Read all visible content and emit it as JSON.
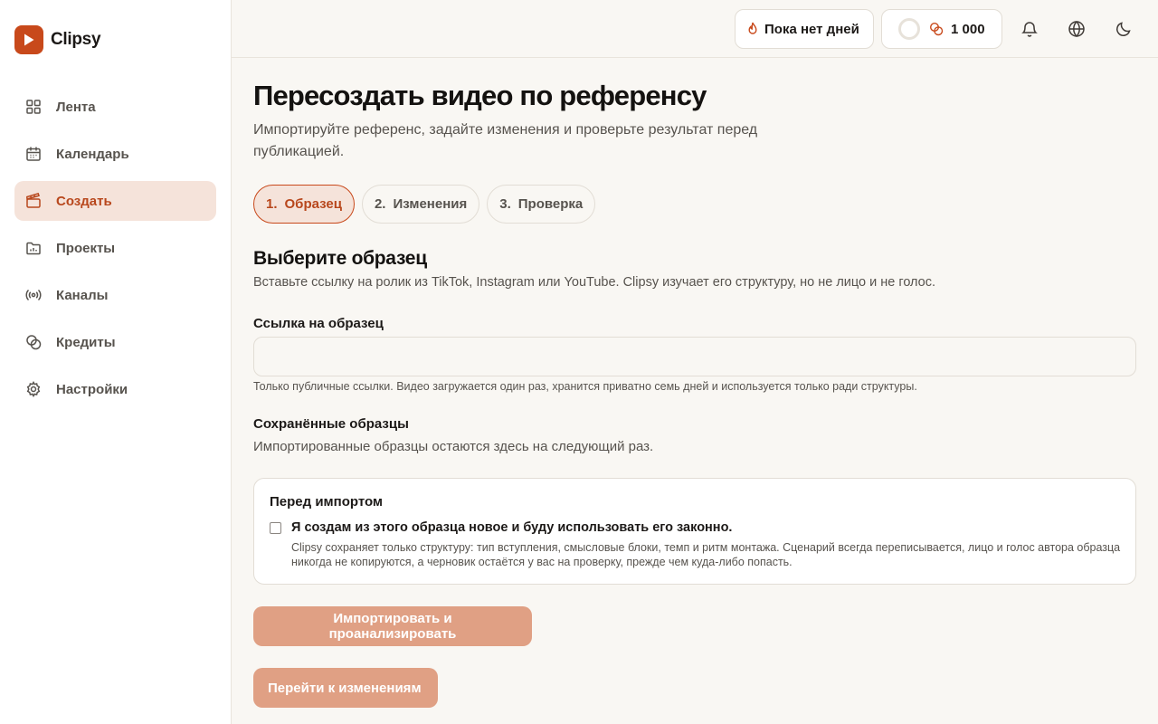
{
  "brand": {
    "name": "Clipsy",
    "accent": "#c8491b"
  },
  "sidebar": {
    "items": [
      {
        "label": "Лента",
        "icon": "grid-icon",
        "active": false
      },
      {
        "label": "Календарь",
        "icon": "calendar-icon",
        "active": false
      },
      {
        "label": "Создать",
        "icon": "clapperboard-icon",
        "active": true
      },
      {
        "label": "Проекты",
        "icon": "folder-icon",
        "active": false
      },
      {
        "label": "Каналы",
        "icon": "broadcast-icon",
        "active": false
      },
      {
        "label": "Кредиты",
        "icon": "coins-icon",
        "active": false
      },
      {
        "label": "Настройки",
        "icon": "gear-icon",
        "active": false
      }
    ]
  },
  "topbar": {
    "streak_label": "Пока нет дней",
    "credits_value": "1 000",
    "icons": [
      "flame-icon",
      "coins-icon",
      "bell-icon",
      "globe-icon",
      "moon-icon"
    ]
  },
  "main": {
    "title": "Пересоздать видео по референсу",
    "subtitle": "Импортируйте референс, задайте изменения и проверьте результат перед публикацией.",
    "steps": [
      {
        "num": "1.",
        "label": "Образец",
        "active": true
      },
      {
        "num": "2.",
        "label": "Изменения",
        "active": false
      },
      {
        "num": "3.",
        "label": "Проверка",
        "active": false
      }
    ],
    "section_title": "Выберите образец",
    "section_desc": "Вставьте ссылку на ролик из TikTok, Instagram или YouTube. Clipsy изучает его структуру, но не лицо и не голос.",
    "link_label": "Ссылка на образец",
    "link_value": "",
    "link_placeholder": "",
    "link_hint": "Только публичные ссылки. Видео загружается один раз, хранится приватно семь дней и используется только ради структуры.",
    "saved_title": "Сохранённые образцы",
    "saved_desc": "Импортированные образцы остаются здесь на следующий раз.",
    "consent": {
      "title": "Перед импортом",
      "checkbox_label": "Я создам из этого образца новое и буду использовать его законно.",
      "checked": false,
      "description": "Clipsy сохраняет только структуру: тип вступления, смысловые блоки, темп и ритм монтажа. Сценарий всегда переписывается, лицо и голос автора образца никогда не копируются, а черновик остаётся у вас на проверку, прежде чем куда-либо попасть."
    },
    "import_button": "Импортировать и проанализировать",
    "next_button": "Перейти к изменениям"
  }
}
